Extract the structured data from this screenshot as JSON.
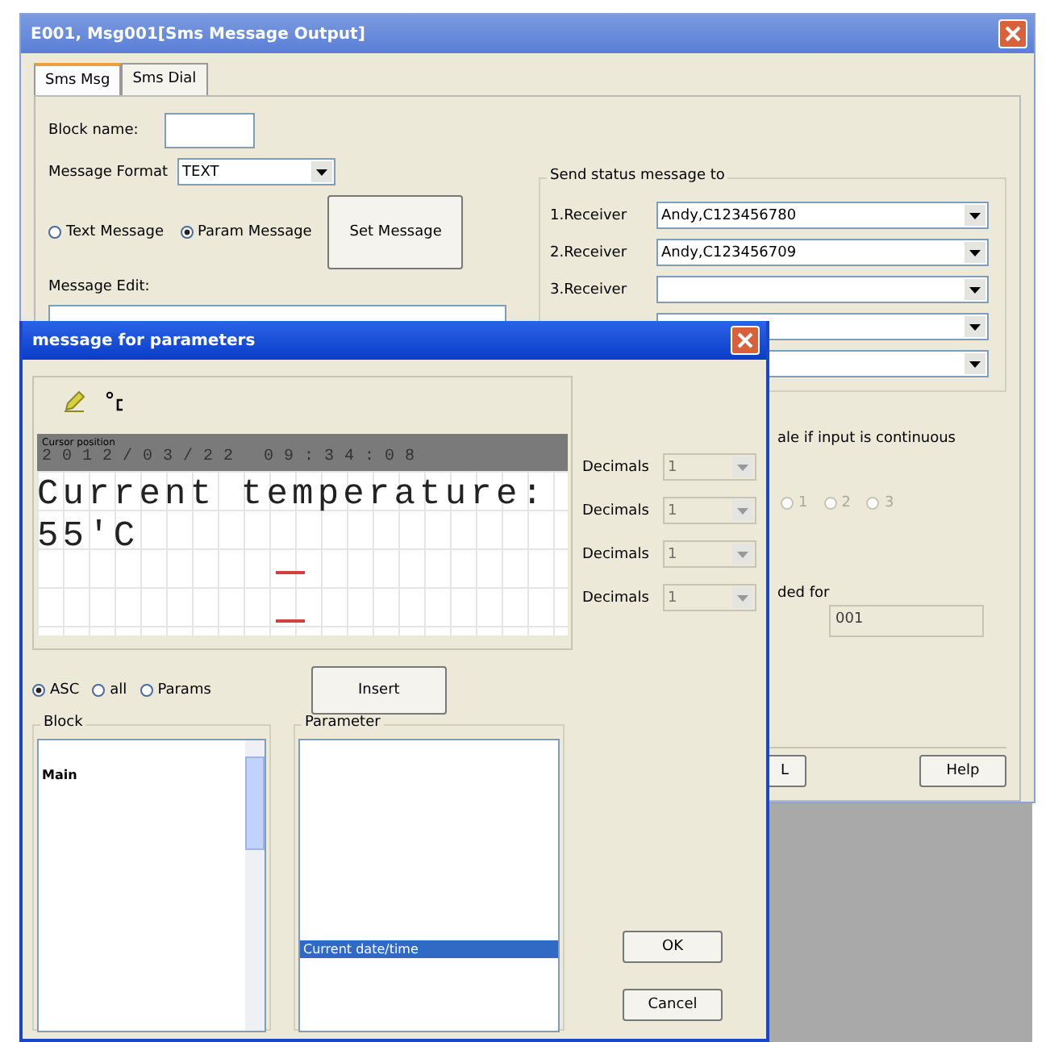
{
  "main_window": {
    "title": "E001, Msg001[Sms Message Output]",
    "tabs": [
      {
        "label": "Sms Msg",
        "selected": true
      },
      {
        "label": "Sms Dial",
        "selected": false
      }
    ],
    "block_name_label": "Block name:",
    "message_format": {
      "label": "Message Format",
      "value": "TEXT"
    },
    "message_types": [
      {
        "label": "Text Message",
        "selected": false
      },
      {
        "label": "Param Message",
        "selected": true
      }
    ],
    "set_message_button": "Set Message",
    "message_edit_label": "Message Edit:",
    "send_status": {
      "title": "Send status message to",
      "receivers": [
        {
          "label": "1.Receiver",
          "value": "Andy,C123456780"
        },
        {
          "label": "2.Receiver",
          "value": "Andy,C123456709"
        },
        {
          "kind": "labeled",
          "label": "3.Receiver"
        },
        {
          "kind": "bare"
        },
        {
          "kind": "bare"
        }
      ]
    },
    "continuous_note": "ale if input is continuous",
    "channel_options": [
      {
        "label": "1",
        "selected": false,
        "disabled": true
      },
      {
        "label": "2",
        "selected": false,
        "disabled": true
      },
      {
        "label": "3",
        "selected": false,
        "disabled": true
      }
    ],
    "used_for": {
      "label": "ded for",
      "value": "001",
      "disabled": true
    },
    "buttons": [
      "L",
      "Help"
    ]
  },
  "param_dialog": {
    "title": "message for parameters",
    "display": {
      "header": "Cursor position",
      "datetime": "2012/03/22 09:34:08",
      "lines": [
        "Current temperature:",
        "55'C"
      ]
    },
    "decimals": [
      {
        "label": "Decimals",
        "value": "1",
        "disabled": true
      },
      {
        "label": "Decimals",
        "value": "1",
        "disabled": true
      },
      {
        "label": "Decimals",
        "value": "1",
        "disabled": true
      },
      {
        "label": "Decimals",
        "value": "1",
        "disabled": true
      }
    ],
    "encodings": [
      {
        "label": "ASC",
        "selected": true
      },
      {
        "label": "all",
        "selected": false
      },
      {
        "label": "Params",
        "selected": false
      }
    ],
    "insert_button": "Insert",
    "block": {
      "title": "Block",
      "items": [
        {
          "label": "Main",
          "selected": false
        }
      ]
    },
    "parameter": {
      "title": "Parameter",
      "items": [
        {
          "label": "Current date/time",
          "selected": true
        }
      ]
    },
    "ok_button": "OK",
    "cancel_button": "Cancel"
  }
}
